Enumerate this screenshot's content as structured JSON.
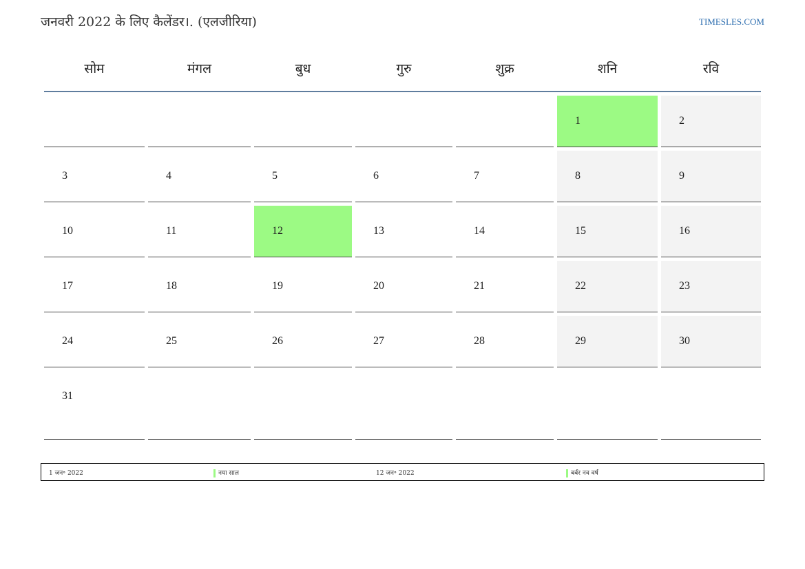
{
  "title": "जनवरी 2022 के लिए कैलेंडर।. (एलजीरिया)",
  "site": "TIMESLES.COM",
  "weekdays": [
    "सोम",
    "मंगल",
    "बुध",
    "गुरु",
    "शुक्र",
    "शनि",
    "रवि"
  ],
  "weeks": [
    [
      "",
      "",
      "",
      "",
      "",
      "1",
      "2"
    ],
    [
      "3",
      "4",
      "5",
      "6",
      "7",
      "8",
      "9"
    ],
    [
      "10",
      "11",
      "12",
      "13",
      "14",
      "15",
      "16"
    ],
    [
      "17",
      "18",
      "19",
      "20",
      "21",
      "22",
      "23"
    ],
    [
      "24",
      "25",
      "26",
      "27",
      "28",
      "29",
      "30"
    ],
    [
      "31",
      "",
      "",
      "",
      "",
      "",
      ""
    ]
  ],
  "holiday_days": [
    "1",
    "12"
  ],
  "colors": {
    "holiday": "#9cfa84",
    "weekend": "#f3f3f3",
    "header_rule": "#5f7d9e",
    "link": "#2f6fb0"
  },
  "legend": [
    {
      "date": "1 जन॰ 2022",
      "name": "नया साल"
    },
    {
      "date": "12 जन॰ 2022",
      "name": "बर्बर नव वर्ष"
    }
  ]
}
